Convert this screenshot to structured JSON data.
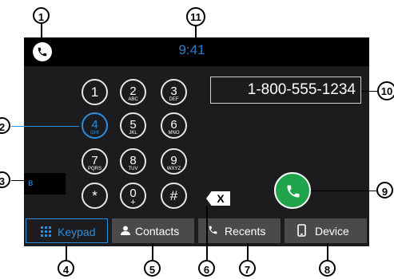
{
  "status": {
    "time": "9:41"
  },
  "keypad": [
    {
      "digit": "1",
      "letters": ""
    },
    {
      "digit": "2",
      "letters": "ABC"
    },
    {
      "digit": "3",
      "letters": "DEF"
    },
    {
      "digit": "4",
      "letters": "GHI"
    },
    {
      "digit": "5",
      "letters": "JKL"
    },
    {
      "digit": "6",
      "letters": "MNO"
    },
    {
      "digit": "7",
      "letters": "PQRS"
    },
    {
      "digit": "8",
      "letters": "TUV"
    },
    {
      "digit": "9",
      "letters": "WXYZ"
    },
    {
      "digit": "*",
      "letters": ""
    },
    {
      "digit": "0",
      "letters": "+"
    },
    {
      "digit": "#",
      "letters": ""
    }
  ],
  "number_display": "1-800-555-1234",
  "bluetooth_symbol": "ʙ",
  "backspace_label": "X",
  "tabs": {
    "keypad": "Keypad",
    "contacts": "Contacts",
    "recents": "Recents",
    "device": "Device"
  },
  "callouts": [
    "1",
    "2",
    "3",
    "4",
    "5",
    "6",
    "7",
    "8",
    "9",
    "10",
    "11"
  ],
  "colors": {
    "accent": "#2a8fe0",
    "call": "#1fa44c",
    "tab_bg": "#4a4a4c",
    "screen_bg": "#1c1c1e"
  }
}
